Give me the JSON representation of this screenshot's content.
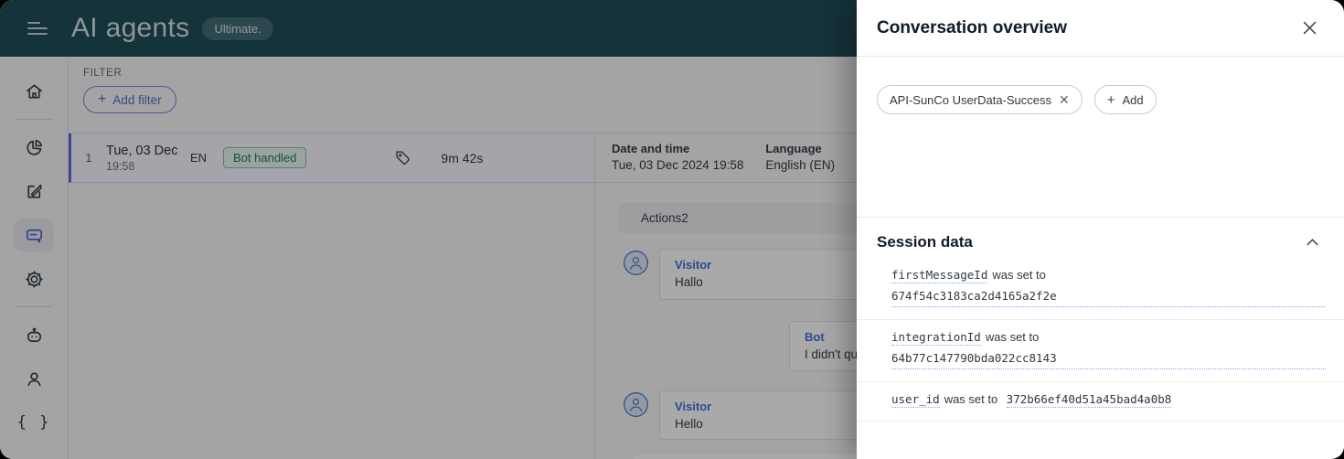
{
  "header": {
    "title": "AI agents",
    "badge": "Ultimate."
  },
  "sidebar": {
    "items": [
      {
        "icon": "home-icon"
      },
      {
        "icon": "analytics-pie-icon"
      },
      {
        "icon": "compose-icon"
      },
      {
        "icon": "conversations-icon",
        "active": true
      },
      {
        "icon": "settings-gear-icon"
      },
      {
        "icon": "bot-icon"
      },
      {
        "icon": "person-icon"
      },
      {
        "icon": "code-braces-icon",
        "glyph": "{ }"
      }
    ]
  },
  "filter": {
    "label": "FILTER",
    "add_button": "Add filter"
  },
  "conversation_list": {
    "rows": [
      {
        "index": "1",
        "date": "Tue, 03 Dec",
        "time": "19:58",
        "language": "EN",
        "status": "Bot handled",
        "duration": "9m 42s"
      }
    ]
  },
  "detail": {
    "date_label": "Date and time",
    "date_value": "Tue, 03 Dec 2024 19:58",
    "language_label": "Language",
    "language_value": "English (EN)",
    "actions_section": "Actions2",
    "messages": [
      {
        "sender": "Visitor",
        "text": "Hallo"
      },
      {
        "sender": "Bot",
        "text": "I didn't qu"
      },
      {
        "sender": "Visitor",
        "text": "Hello"
      }
    ]
  },
  "drawer": {
    "title": "Conversation overview",
    "tags": [
      {
        "label": "API-SunCo UserData-Success"
      }
    ],
    "add_button": "Add",
    "session": {
      "title": "Session data",
      "entries": [
        {
          "key": "firstMessageId",
          "mid": "was set to",
          "value": "674f54c3183ca2d4165a2f2e"
        },
        {
          "key": "integrationId",
          "mid": "was set to",
          "value": "64b77c147790bda022cc8143"
        },
        {
          "key": "user_id",
          "mid": "was set to",
          "value": "372b66ef40d51a45bad4a0b8"
        }
      ]
    }
  },
  "colors": {
    "header_teal": "#1b4a54",
    "accent_indigo": "#5a68d8",
    "link_blue": "#3d6ed9",
    "status_green": "#1d7d55",
    "dotted_underline": "#97a2ec"
  }
}
